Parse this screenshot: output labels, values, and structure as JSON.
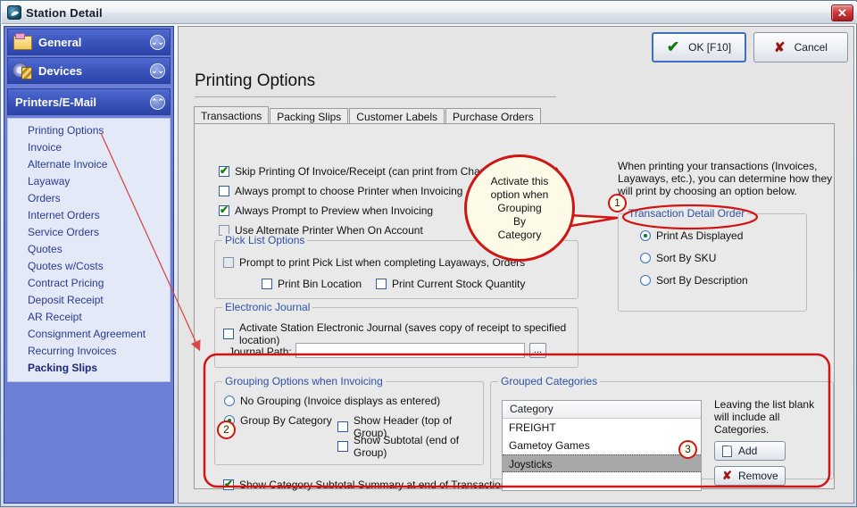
{
  "window": {
    "title": "Station Detail",
    "icon": "app-icon",
    "close_label": "✕"
  },
  "sidebar": {
    "sections": [
      {
        "label": "General",
        "icon": "folder-icon",
        "chevron": "⌄⌄"
      },
      {
        "label": "Devices",
        "icon": "gear-icon",
        "chevron": "⌄⌄"
      },
      {
        "label": "Printers/E-Mail",
        "icon": "none",
        "chevron": "⌃⌃"
      }
    ],
    "items": [
      {
        "label": "Printing Options",
        "selected": false
      },
      {
        "label": "Invoice",
        "selected": false
      },
      {
        "label": "Alternate Invoice",
        "selected": false
      },
      {
        "label": "Layaway",
        "selected": false
      },
      {
        "label": "Orders",
        "selected": false
      },
      {
        "label": "Internet Orders",
        "selected": false
      },
      {
        "label": "Service Orders",
        "selected": false
      },
      {
        "label": "Quotes",
        "selected": false
      },
      {
        "label": "Quotes w/Costs",
        "selected": false
      },
      {
        "label": "Contract Pricing",
        "selected": false
      },
      {
        "label": "Deposit Receipt",
        "selected": false
      },
      {
        "label": "AR Receipt",
        "selected": false
      },
      {
        "label": "Consignment Agreement",
        "selected": false
      },
      {
        "label": "Recurring Invoices",
        "selected": false
      },
      {
        "label": "Packing Slips",
        "selected": true
      }
    ]
  },
  "buttons": {
    "ok": "OK [F10]",
    "cancel": "Cancel",
    "ok_icon": "✔",
    "cancel_icon": "✘"
  },
  "page": {
    "title": "Printing Options"
  },
  "tabs": [
    {
      "label": "Transactions",
      "active": true
    },
    {
      "label": "Packing Slips",
      "active": false
    },
    {
      "label": "Customer Labels",
      "active": false
    },
    {
      "label": "Purchase Orders",
      "active": false
    }
  ],
  "print_options": [
    {
      "label": "Skip Printing Of Invoice/Receipt (can print from Change Due screen)",
      "checked": true
    },
    {
      "label": "Always prompt to choose Printer when Invoicing",
      "checked": false
    },
    {
      "label": "Always Prompt to Preview when Invoicing",
      "checked": true
    },
    {
      "label": "Use Alternate Printer When On Account",
      "checked": false
    }
  ],
  "pick_list": {
    "legend": "Pick List Options",
    "prompt": {
      "label": "Prompt to print Pick List when completing Layaways, Orders",
      "checked": false
    },
    "bin": {
      "label": "Print Bin Location",
      "checked": false
    },
    "stock": {
      "label": "Print Current Stock Quantity",
      "checked": false
    }
  },
  "electronic_journal": {
    "legend": "Electronic Journal",
    "activate": {
      "label": "Activate Station Electronic Journal (saves copy of receipt to specified location)",
      "checked": false
    },
    "path_label": "Journal Path:",
    "path_value": "",
    "path_placeholder": "",
    "browse_label": "..."
  },
  "transaction_detail": {
    "intro": "When printing your transactions (Invoices, Layaways, etc.), you can determine how they will print by choosing an option below.",
    "legend": "Transaction Detail Order",
    "options": [
      {
        "label": "Print As Displayed",
        "selected": true
      },
      {
        "label": "Sort By SKU",
        "selected": false
      },
      {
        "label": "Sort By Description",
        "selected": false
      }
    ]
  },
  "grouping": {
    "legend": "Grouping Options when Invoicing",
    "radios": [
      {
        "label": "No Grouping (Invoice displays as entered)",
        "selected": false
      },
      {
        "label": "Group By Category",
        "selected": true
      }
    ],
    "show_header": {
      "label": "Show Header (top of Group)",
      "checked": false
    },
    "show_subtotal": {
      "label": "Show Subtotal (end of Group)",
      "checked": false
    },
    "summary": {
      "label": "Show Category Subtotal Summary at end of Transaction",
      "checked": true
    }
  },
  "grouped_categories": {
    "legend": "Grouped Categories",
    "column_header": "Category",
    "rows": [
      {
        "label": "FREIGHT",
        "selected": false
      },
      {
        "label": "Gametoy Games",
        "selected": false
      },
      {
        "label": "Joysticks",
        "selected": true
      },
      {
        "label": "",
        "selected": false
      }
    ],
    "note": "Leaving the list blank will include all Categories.",
    "add_label": "Add",
    "remove_label": "Remove"
  },
  "annotations": {
    "callout": "Activate this option when Grouping By Category",
    "callout_lines": [
      "Activate this",
      "option when",
      "Grouping",
      "By",
      "Category"
    ],
    "marker1": "1",
    "marker2": "2",
    "marker3": "3",
    "accent_color": "#d01515"
  }
}
